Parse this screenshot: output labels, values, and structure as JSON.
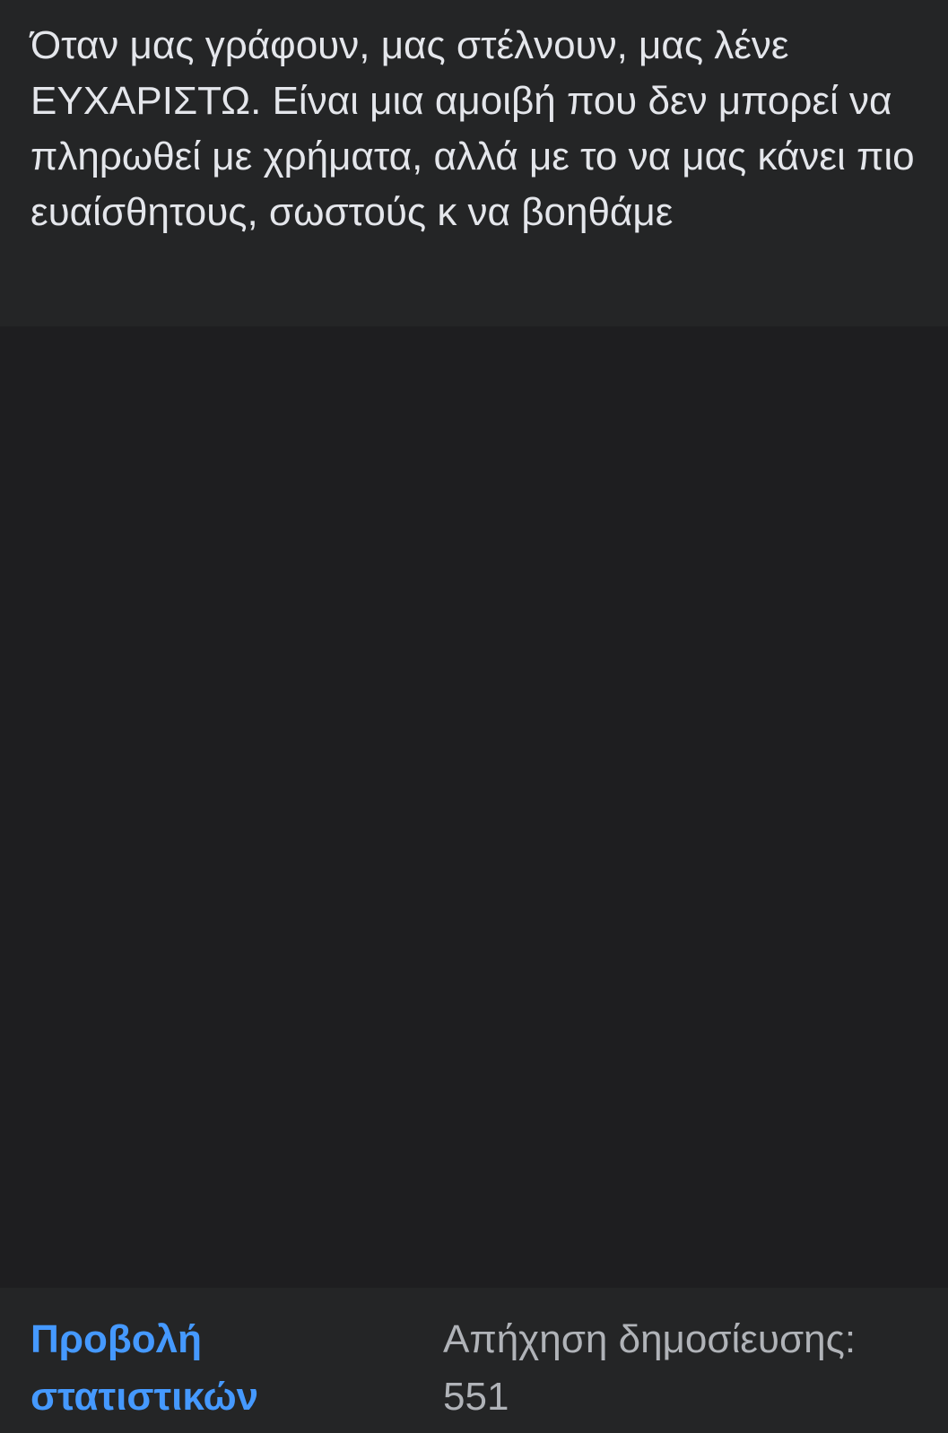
{
  "caption": "Όταν μας γράφουν, μας στέλνουν, μας λένε ΕΥΧΑΡΙΣΤΩ. Είναι μια αμοιβή που δεν μπορεί να πληρωθεί με χρήματα, αλλά με το να μας κάνει πιο ευαίσθητους, σωστούς κ να βοηθάμε",
  "footer": {
    "stats_link": "Προβολή στατιστικών",
    "reach_label": "Απήχηση δημοσίευσης:",
    "reach_value": "551"
  },
  "colors": {
    "background": "#242526",
    "text": "#e4e6eb",
    "link": "#4599ff",
    "muted": "#b0b3b8"
  }
}
